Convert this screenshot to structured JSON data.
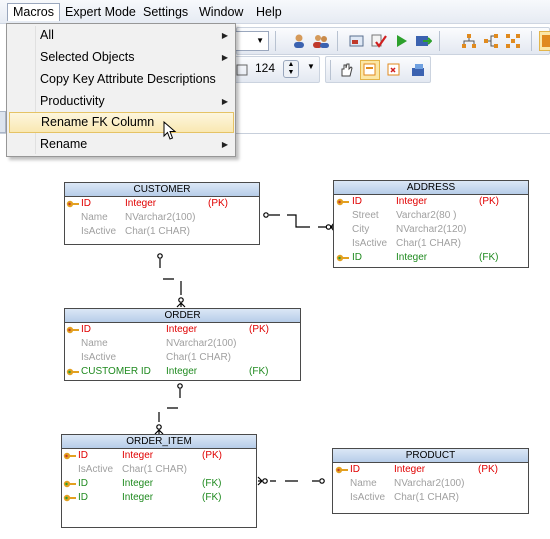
{
  "menubar": {
    "items": [
      {
        "label": "Macros",
        "active": true
      },
      {
        "label": "Expert Mode"
      },
      {
        "label": "Settings"
      },
      {
        "label": "Window"
      },
      {
        "label": "Help"
      }
    ]
  },
  "toolbar": {
    "zoom_value": "124"
  },
  "macros_menu": {
    "items": [
      {
        "label": "All",
        "submenu": true
      },
      {
        "label": "Selected Objects",
        "submenu": true
      },
      {
        "label": "Copy Key Attribute Descriptions",
        "submenu": false
      },
      {
        "label": "Productivity",
        "submenu": true
      },
      {
        "label": "Rename FK Column",
        "submenu": false,
        "highlighted": true
      },
      {
        "label": "Rename",
        "submenu": true
      }
    ]
  },
  "colors": {
    "pk": "#e00000",
    "fk": "#1f8a1f",
    "attribute": "#a0a0a0",
    "entity_header": "#c6d8ee"
  },
  "entities": {
    "customer": {
      "name": "CUSTOMER",
      "rows": [
        {
          "key": "pk",
          "name": "ID",
          "type": "Integer",
          "tag": "(PK)"
        },
        {
          "key": "",
          "name": "Name",
          "type": "NVarchar2(100)",
          "tag": ""
        },
        {
          "key": "",
          "name": "IsActive",
          "type": "Char(1 CHAR)",
          "tag": ""
        }
      ]
    },
    "address": {
      "name": "ADDRESS",
      "rows": [
        {
          "key": "pk",
          "name": "ID",
          "type": "Integer",
          "tag": "(PK)"
        },
        {
          "key": "",
          "name": "Street",
          "type": "Varchar2(80 )",
          "tag": ""
        },
        {
          "key": "",
          "name": "City",
          "type": "NVarchar2(120)",
          "tag": ""
        },
        {
          "key": "",
          "name": "IsActive",
          "type": "Char(1 CHAR)",
          "tag": ""
        },
        {
          "key": "fk",
          "name": "ID",
          "type": "Integer",
          "tag": "(FK)"
        }
      ]
    },
    "order": {
      "name": "ORDER",
      "rows": [
        {
          "key": "pk",
          "name": "ID",
          "type": "Integer",
          "tag": "(PK)"
        },
        {
          "key": "",
          "name": "Name",
          "type": "NVarchar2(100)",
          "tag": ""
        },
        {
          "key": "",
          "name": "IsActive",
          "type": "Char(1 CHAR)",
          "tag": ""
        },
        {
          "key": "fk",
          "name": "CUSTOMER ID",
          "type": "Integer",
          "tag": "(FK)"
        }
      ]
    },
    "order_item": {
      "name": "ORDER_ITEM",
      "rows": [
        {
          "key": "pk",
          "name": "ID",
          "type": "Integer",
          "tag": "(PK)"
        },
        {
          "key": "",
          "name": "IsActive",
          "type": "Char(1 CHAR)",
          "tag": ""
        },
        {
          "key": "fk",
          "name": "ID",
          "type": "Integer",
          "tag": "(FK)"
        },
        {
          "key": "fk",
          "name": "ID",
          "type": "Integer",
          "tag": "(FK)"
        }
      ]
    },
    "product": {
      "name": "PRODUCT",
      "rows": [
        {
          "key": "pk",
          "name": "ID",
          "type": "Integer",
          "tag": "(PK)"
        },
        {
          "key": "",
          "name": "Name",
          "type": "NVarchar2(100)",
          "tag": ""
        },
        {
          "key": "",
          "name": "IsActive",
          "type": "Char(1 CHAR)",
          "tag": ""
        }
      ]
    }
  }
}
